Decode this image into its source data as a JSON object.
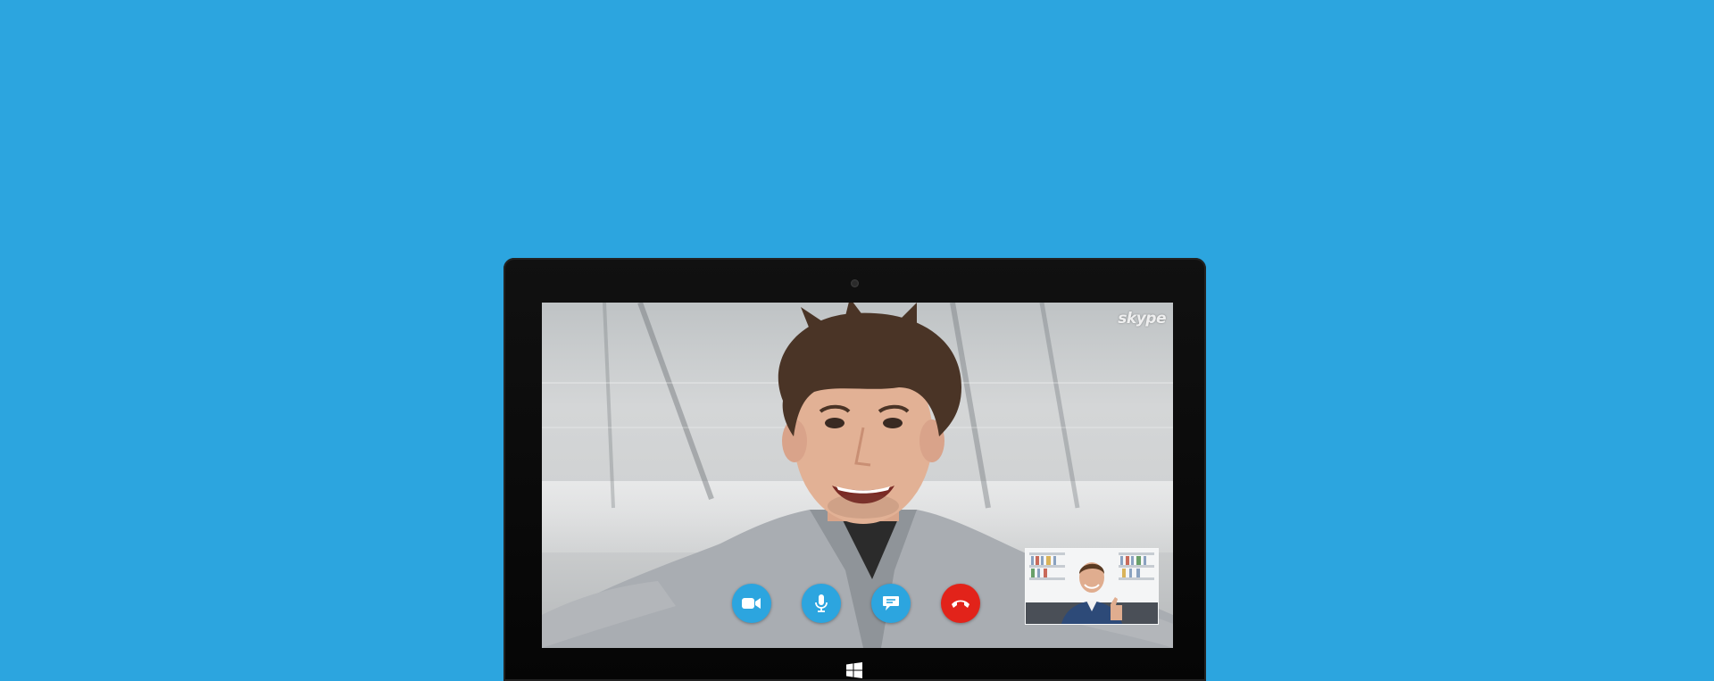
{
  "app": {
    "brand_logo_text": "skype"
  },
  "call_controls": [
    {
      "id": "video",
      "icon": "video-camera-icon",
      "color": "#2ca5df"
    },
    {
      "id": "microphone",
      "icon": "microphone-icon",
      "color": "#2ca5df"
    },
    {
      "id": "chat",
      "icon": "chat-bubble-icon",
      "color": "#2ca5df"
    },
    {
      "id": "end_call",
      "icon": "hang-up-phone-icon",
      "color": "#e2231a"
    }
  ],
  "colors": {
    "background": "#2ca5df",
    "accent": "#2ca5df",
    "end_call": "#e2231a",
    "device": "#0a0a0a"
  },
  "device": {
    "type": "tablet",
    "system_icon": "windows-logo-icon"
  }
}
